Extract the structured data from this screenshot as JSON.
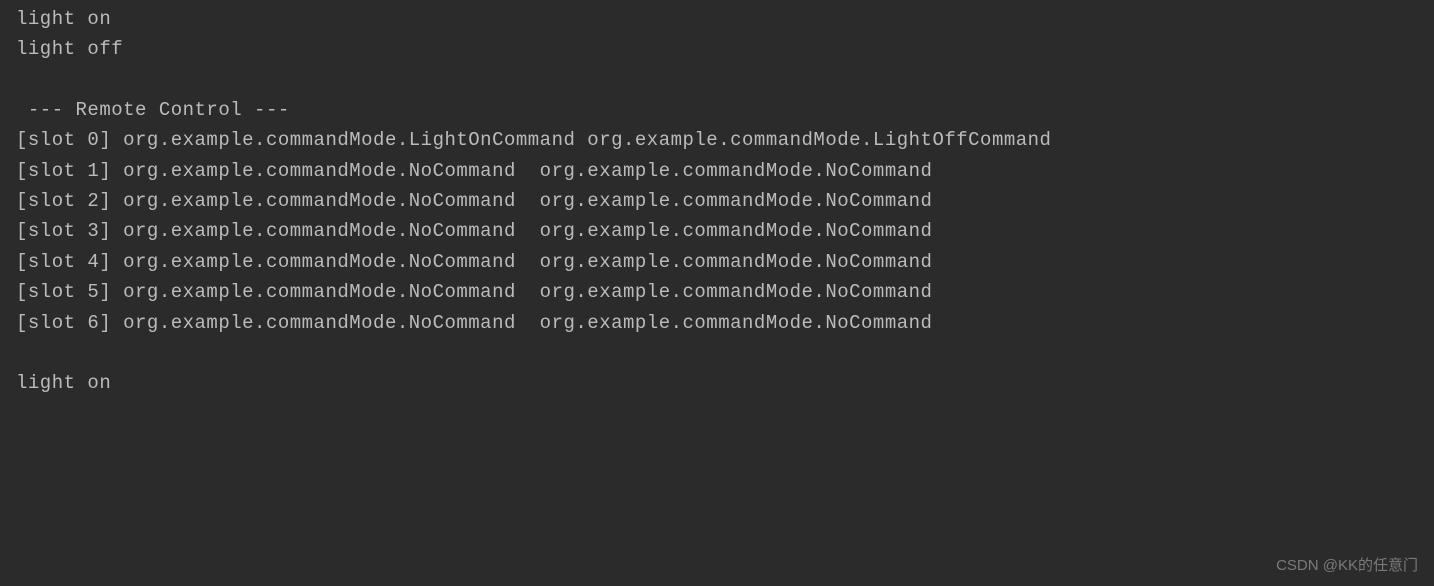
{
  "lines": {
    "l0": "light on",
    "l1": "light off",
    "l2": "",
    "l3": " --- Remote Control ---",
    "l4": "[slot 0] org.example.commandMode.LightOnCommand org.example.commandMode.LightOffCommand",
    "l5": "[slot 1] org.example.commandMode.NoCommand  org.example.commandMode.NoCommand",
    "l6": "[slot 2] org.example.commandMode.NoCommand  org.example.commandMode.NoCommand",
    "l7": "[slot 3] org.example.commandMode.NoCommand  org.example.commandMode.NoCommand",
    "l8": "[slot 4] org.example.commandMode.NoCommand  org.example.commandMode.NoCommand",
    "l9": "[slot 5] org.example.commandMode.NoCommand  org.example.commandMode.NoCommand",
    "l10": "[slot 6] org.example.commandMode.NoCommand  org.example.commandMode.NoCommand",
    "l11": "",
    "l12": "light on"
  },
  "watermark": "CSDN @KK的任意门"
}
